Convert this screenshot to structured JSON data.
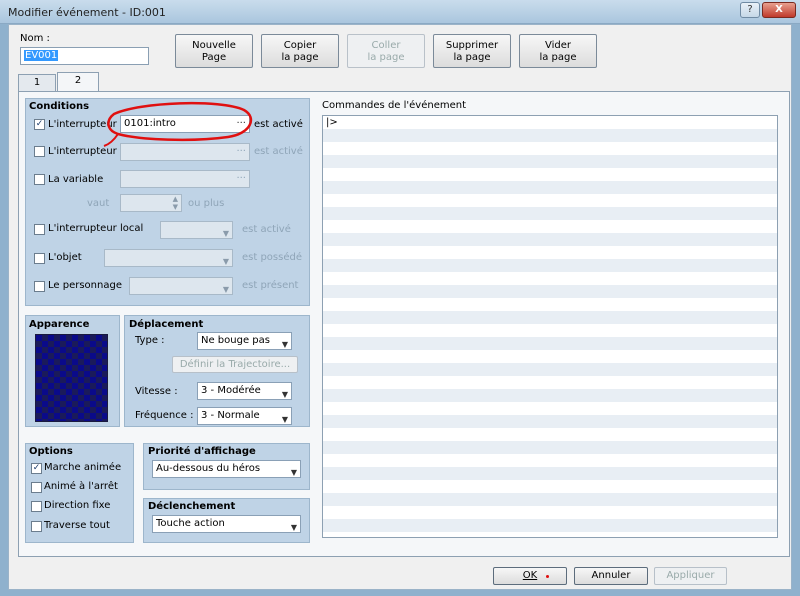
{
  "window": {
    "title": "Modifier événement - ID:001",
    "help_label": "?",
    "close_label": "X"
  },
  "event": {
    "name_label": "Nom :",
    "name_value": "EV001"
  },
  "page_buttons": [
    {
      "line1": "Nouvelle",
      "line2": "Page",
      "enabled": true
    },
    {
      "line1": "Copier",
      "line2": "la page",
      "enabled": true
    },
    {
      "line1": "Coller",
      "line2": "la page",
      "enabled": false
    },
    {
      "line1": "Supprimer",
      "line2": "la page",
      "enabled": true
    },
    {
      "line1": "Vider",
      "line2": "la page",
      "enabled": true
    }
  ],
  "tabs": [
    {
      "label": "1"
    },
    {
      "label": "2"
    }
  ],
  "conditions": {
    "title": "Conditions",
    "switch1": {
      "label": "L'interrupteur",
      "value": "0101:intro",
      "suffix": "est activé",
      "checked": true
    },
    "switch2": {
      "label": "L'interrupteur",
      "value": "",
      "suffix": "est activé",
      "checked": false
    },
    "variable": {
      "label": "La variable",
      "value": "",
      "vaut": "vaut",
      "ou_plus": "ou plus",
      "checked": false
    },
    "local_switch": {
      "label": "L'interrupteur local",
      "value": "",
      "suffix": "est activé",
      "checked": false
    },
    "item": {
      "label": "L'objet",
      "value": "",
      "suffix": "est possédé",
      "checked": false
    },
    "actor": {
      "label": "Le personnage",
      "value": "",
      "suffix": "est présent",
      "checked": false
    }
  },
  "appearance": {
    "title": "Apparence"
  },
  "movement": {
    "title": "Déplacement",
    "type_label": "Type :",
    "type_value": "Ne bouge pas",
    "route_button": "Définir la Trajectoire...",
    "speed_label": "Vitesse :",
    "speed_value": "3 - Modérée",
    "freq_label": "Fréquence :",
    "freq_value": "3 - Normale"
  },
  "options": {
    "title": "Options",
    "items": [
      {
        "label": "Marche animée",
        "checked": true
      },
      {
        "label": "Animé à l'arrêt",
        "checked": false
      },
      {
        "label": "Direction fixe",
        "checked": false
      },
      {
        "label": "Traverse tout",
        "checked": false
      }
    ]
  },
  "priority": {
    "title": "Priorité d'affichage",
    "value": "Au-dessous du héros"
  },
  "trigger": {
    "title": "Déclenchement",
    "value": "Touche action"
  },
  "commands": {
    "title": "Commandes de l'événement",
    "first_row": "|>"
  },
  "footer": {
    "ok": "OK",
    "cancel": "Annuler",
    "apply": "Appliquer"
  },
  "colors": {
    "annotation": "#e01010",
    "titlebar": "#aac6de",
    "groupbox": "#bfd3e6"
  }
}
